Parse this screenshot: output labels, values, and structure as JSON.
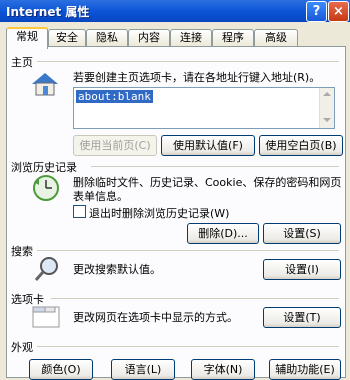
{
  "window": {
    "title": "Internet 属性",
    "help": "?",
    "close": "×"
  },
  "tabs": [
    "常规",
    "安全",
    "隐私",
    "内容",
    "连接",
    "程序",
    "高级"
  ],
  "home": {
    "section": "主页",
    "desc": "若要创建主页选项卡，请在各地址行键入地址(R)。",
    "address": "about:blank",
    "btn_current": "使用当前页(C)",
    "btn_default": "使用默认值(F)",
    "btn_blank": "使用空白页(B)"
  },
  "history": {
    "section": "浏览历史记录",
    "desc1": "删除临时文件、历史记录、Cookie、保存的密码和网页",
    "desc2": "表单信息。",
    "checkbox": "退出时删除浏览历史记录(W)",
    "btn_delete": "删除(D)...",
    "btn_settings": "设置(S)"
  },
  "search": {
    "section": "搜索",
    "desc": "更改搜索默认值。",
    "btn_settings": "设置(I)"
  },
  "tabs_section": {
    "section": "选项卡",
    "desc": "更改网页在选项卡中显示的方式。",
    "btn_settings": "设置(T)"
  },
  "appearance": {
    "section": "外观",
    "btn_colors": "颜色(O)",
    "btn_languages": "语言(L)",
    "btn_fonts": "字体(N)",
    "btn_accessibility": "辅助功能(E)"
  }
}
